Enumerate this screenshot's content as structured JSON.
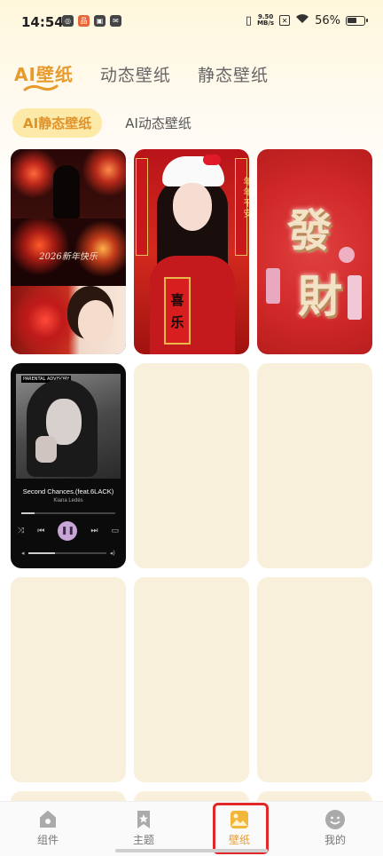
{
  "status_bar": {
    "time": "14:54",
    "net_speed_value": "9.50",
    "net_speed_unit": "MB/s",
    "battery": "56%"
  },
  "top_tabs": [
    {
      "label": "AI壁纸",
      "active": true
    },
    {
      "label": "动态壁纸",
      "active": false
    },
    {
      "label": "静态壁纸",
      "active": false
    }
  ],
  "sub_tabs": [
    {
      "label": "AI静态壁纸",
      "active": true
    },
    {
      "label": "AI动态壁纸",
      "active": false
    }
  ],
  "cards": {
    "card1_text": "2026新年快乐",
    "card2_scroll": [
      "喜",
      "乐"
    ],
    "card2_couplet": "年年平安",
    "card3_chars": [
      "發",
      "財"
    ],
    "card4_song": "Second Chances.(feat.6LACK)",
    "card4_artist": "Kiana Ledés",
    "card4_advisory": "PARENTAL ADVISORY",
    "card4_progress": 0.14,
    "card4_volume": 0.35
  },
  "bottom_nav": [
    {
      "label": "组件",
      "icon": "home-icon",
      "active": false
    },
    {
      "label": "主题",
      "icon": "bookmark-star-icon",
      "active": false
    },
    {
      "label": "壁纸",
      "icon": "wallpaper-image-icon",
      "active": true
    },
    {
      "label": "我的",
      "icon": "smiley-face-icon",
      "active": false
    }
  ],
  "colors": {
    "accent": "#e89a2b",
    "sub_tab_active_bg": "#fde9a8",
    "placeholder_card": "#f9f0db",
    "highlight": "#e02828"
  }
}
